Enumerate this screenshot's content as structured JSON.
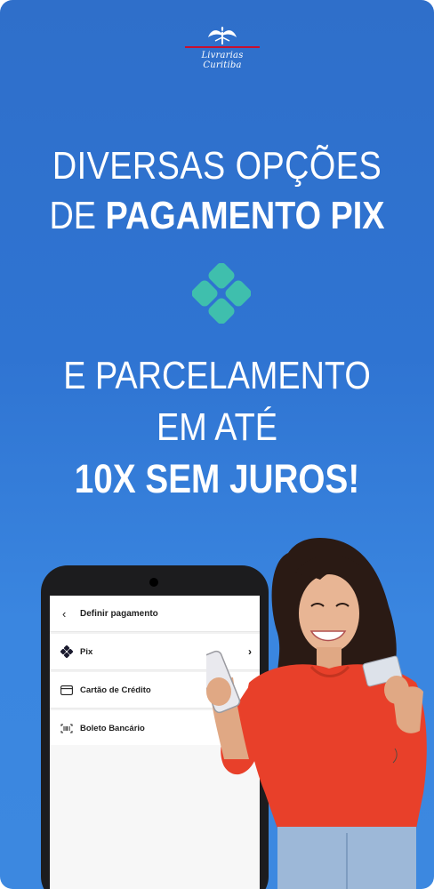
{
  "brand": {
    "name": "Livrarias Curitiba"
  },
  "headline": {
    "line1": "DIVERSAS OPÇÕES",
    "line2_light": "DE ",
    "line2_bold": "PAGAMENTO PIX",
    "line3": "E PARCELAMENTO",
    "line4": "EM ATÉ",
    "line5": "10X SEM JUROS!"
  },
  "phone": {
    "screen_title": "Definir pagamento",
    "options": [
      {
        "label": "Pix",
        "icon": "pix-icon",
        "has_chevron": true
      },
      {
        "label": "Cartão de Crédito",
        "icon": "credit-card-icon",
        "has_chevron": false
      },
      {
        "label": "Boleto Bancário",
        "icon": "barcode-icon",
        "has_chevron": false
      }
    ]
  },
  "colors": {
    "background_top": "#2f6fca",
    "background_bottom": "#3c88e0",
    "pix_logo": "#3fbfad",
    "shirt": "#e8402a"
  }
}
